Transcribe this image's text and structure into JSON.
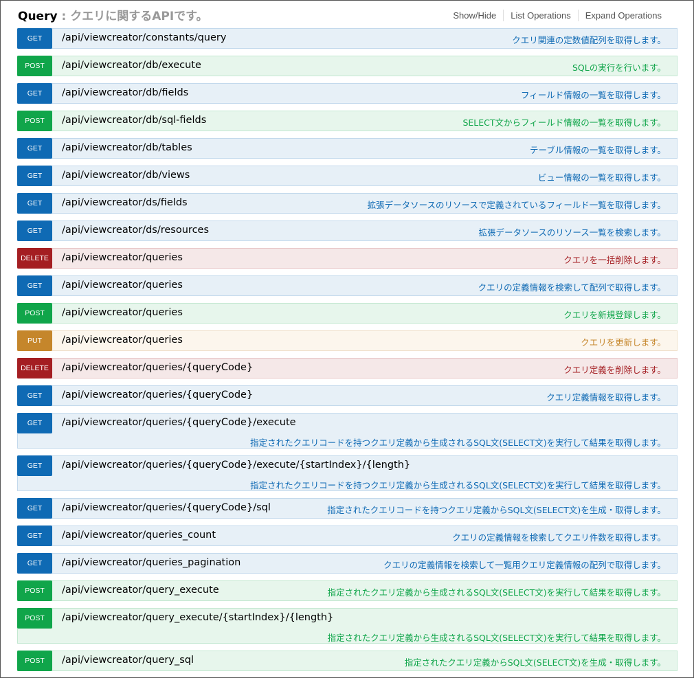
{
  "section": {
    "name": "Query",
    "separator": " : ",
    "description": "クエリに関するAPIです。"
  },
  "operations": {
    "show_hide": "Show/Hide",
    "list_operations": "List Operations",
    "expand_operations": "Expand Operations"
  },
  "endpoints": [
    {
      "method": "GET",
      "path": "/api/viewcreator/constants/query",
      "summary": "クエリ関連の定数値配列を取得します。"
    },
    {
      "method": "POST",
      "path": "/api/viewcreator/db/execute",
      "summary": "SQLの実行を行います。"
    },
    {
      "method": "GET",
      "path": "/api/viewcreator/db/fields",
      "summary": "フィールド情報の一覧を取得します。"
    },
    {
      "method": "POST",
      "path": "/api/viewcreator/db/sql-fields",
      "summary": "SELECT文からフィールド情報の一覧を取得します。"
    },
    {
      "method": "GET",
      "path": "/api/viewcreator/db/tables",
      "summary": "テーブル情報の一覧を取得します。"
    },
    {
      "method": "GET",
      "path": "/api/viewcreator/db/views",
      "summary": "ビュー情報の一覧を取得します。"
    },
    {
      "method": "GET",
      "path": "/api/viewcreator/ds/fields",
      "summary": "拡張データソースのリソースで定義されているフィールド一覧を取得します。"
    },
    {
      "method": "GET",
      "path": "/api/viewcreator/ds/resources",
      "summary": "拡張データソースのリソース一覧を検索します。"
    },
    {
      "method": "DELETE",
      "path": "/api/viewcreator/queries",
      "summary": "クエリを一括削除します。"
    },
    {
      "method": "GET",
      "path": "/api/viewcreator/queries",
      "summary": "クエリの定義情報を検索して配列で取得します。"
    },
    {
      "method": "POST",
      "path": "/api/viewcreator/queries",
      "summary": "クエリを新規登録します。"
    },
    {
      "method": "PUT",
      "path": "/api/viewcreator/queries",
      "summary": "クエリを更新します。"
    },
    {
      "method": "DELETE",
      "path": "/api/viewcreator/queries/{queryCode}",
      "summary": "クエリ定義を削除します。"
    },
    {
      "method": "GET",
      "path": "/api/viewcreator/queries/{queryCode}",
      "summary": "クエリ定義情報を取得します。"
    },
    {
      "method": "GET",
      "path": "/api/viewcreator/queries/{queryCode}/execute",
      "summary": "指定されたクエリコードを持つクエリ定義から生成されるSQL文(SELECT文)を実行して結果を取得します。"
    },
    {
      "method": "GET",
      "path": "/api/viewcreator/queries/{queryCode}/execute/{startIndex}/{length}",
      "summary": "指定されたクエリコードを持つクエリ定義から生成されるSQL文(SELECT文)を実行して結果を取得します。"
    },
    {
      "method": "GET",
      "path": "/api/viewcreator/queries/{queryCode}/sql",
      "summary": "指定されたクエリコードを持つクエリ定義からSQL文(SELECT文)を生成・取得します。"
    },
    {
      "method": "GET",
      "path": "/api/viewcreator/queries_count",
      "summary": "クエリの定義情報を検索してクエリ件数を取得します。"
    },
    {
      "method": "GET",
      "path": "/api/viewcreator/queries_pagination",
      "summary": "クエリの定義情報を検索して一覧用クエリ定義情報の配列で取得します。"
    },
    {
      "method": "POST",
      "path": "/api/viewcreator/query_execute",
      "summary": "指定されたクエリ定義から生成されるSQL文(SELECT文)を実行して結果を取得します。"
    },
    {
      "method": "POST",
      "path": "/api/viewcreator/query_execute/{startIndex}/{length}",
      "summary": "指定されたクエリ定義から生成されるSQL文(SELECT文)を実行して結果を取得します。"
    },
    {
      "method": "POST",
      "path": "/api/viewcreator/query_sql",
      "summary": "指定されたクエリ定義からSQL文(SELECT文)を生成・取得します。"
    }
  ]
}
